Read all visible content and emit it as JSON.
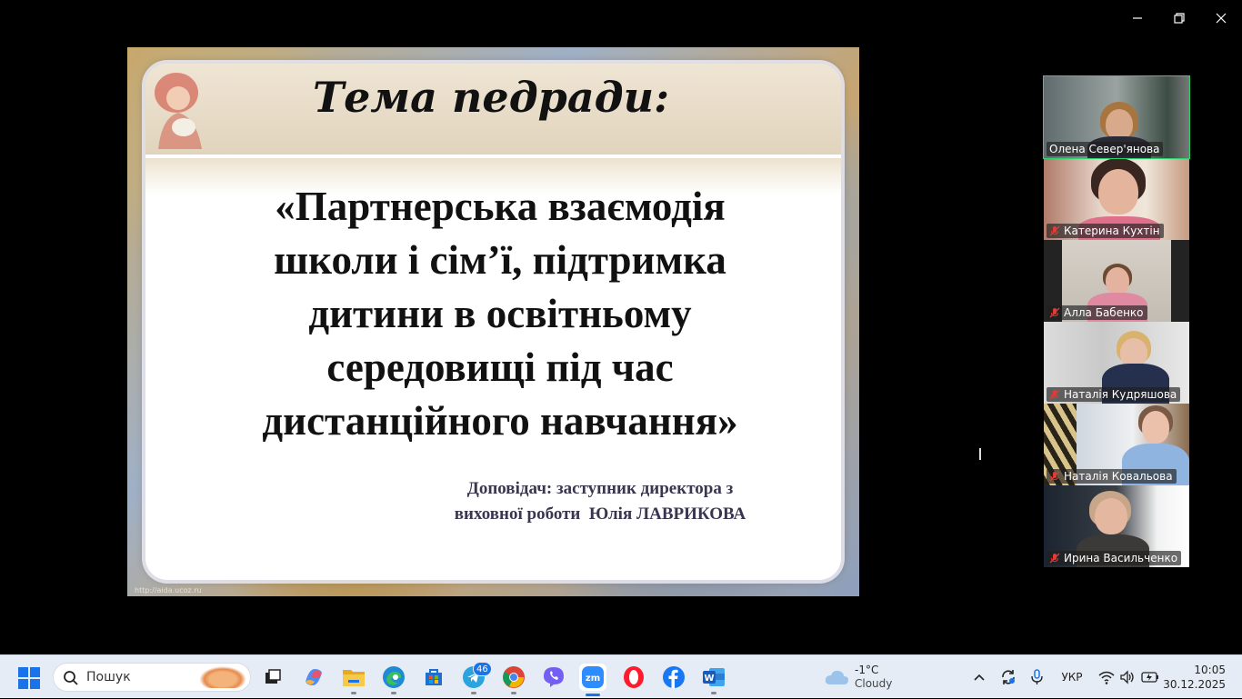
{
  "window": {
    "minimize": "minimize",
    "maximize": "restore",
    "close": "close"
  },
  "slide": {
    "title": "Тема педради:",
    "main_lines": [
      "«Партнерська взаємодія",
      "школи і сім’ї, підтримка",
      "дитини в освітньому",
      "середовищі під час",
      "дистанційного навчання»"
    ],
    "speaker_lines": [
      "Доповідач: заступник директора з",
      "виховної роботи  Юлія ЛАВРИКОВА"
    ],
    "url": "http://aida.ucoz.ru"
  },
  "participants": [
    {
      "name": "Олена Север'янова",
      "muted": false,
      "active": true
    },
    {
      "name": "Катерина Кухтін",
      "muted": true,
      "active": false
    },
    {
      "name": "Алла Бабенко",
      "muted": true,
      "active": false
    },
    {
      "name": "Наталія Кудряшова",
      "muted": true,
      "active": false
    },
    {
      "name": "Наталія Ковальова",
      "muted": true,
      "active": false
    },
    {
      "name": "Ирина Васильченко",
      "muted": true,
      "active": false
    }
  ],
  "taskbar": {
    "search_placeholder": "Пошук",
    "telegram_badge": "46",
    "weather": {
      "temp": "-1°C",
      "condition": "Cloudy"
    },
    "language": "УКР",
    "time": "10:05",
    "date": "30.12.2025",
    "apps": [
      "task-view",
      "copilot",
      "file-explorer",
      "edge",
      "microsoft-store",
      "telegram",
      "chrome",
      "viber",
      "zoom",
      "opera",
      "facebook",
      "word"
    ]
  },
  "colors": {
    "active_speaker": "#2dd36f",
    "taskbar_bg": "#e6ecf5",
    "accent": "#1a73e8"
  }
}
